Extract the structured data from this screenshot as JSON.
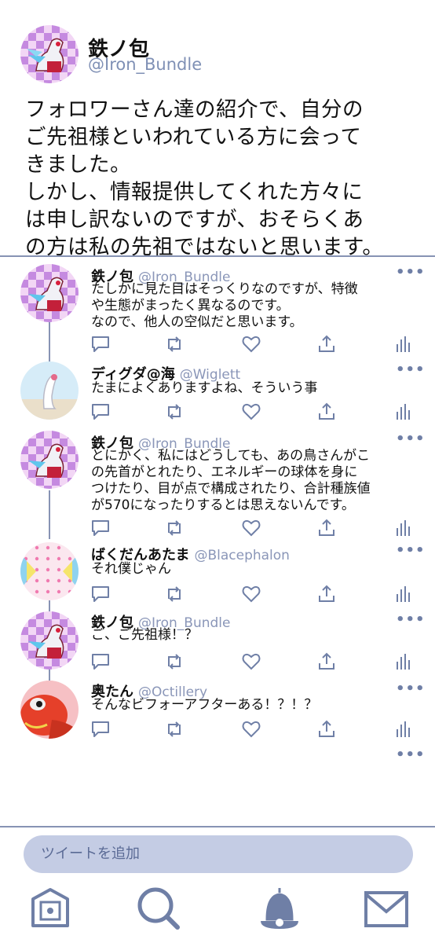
{
  "main_tweet": {
    "name": "鉄ノ包",
    "handle": "@Iron_Bundle",
    "text": "フォロワーさん達の紹介で、自分の\nご先祖様といわれている方に会って\nきました。\nしかし、情報提供してくれた方々に\nは申し訳ないのですが、おそらくあ\nの方は私の先祖ではないと思います。"
  },
  "replies": [
    {
      "name": "鉄ノ包",
      "handle": "@Iron_Bundle",
      "text": "たしかに見た目はそっくりなのですが、特徴\nや生態がまったく異なるのです。\nなので、他人の空似だと思います。",
      "avatar": "iron-bundle-avatar"
    },
    {
      "name": "ディグダ@海",
      "handle": "@Wiglett",
      "text": "たまによくありますよね、そういう事",
      "avatar": "wiglett-avatar"
    },
    {
      "name": "鉄ノ包",
      "handle": "@Iron_Bundle",
      "text": "とにかく、私にはどうしても、あの鳥さんがこ\nの先首がとれたり、エネルギーの球体を身に\nつけたり、目が点で構成されたり、合計種族値\nが570になったりするとは思えないんです。",
      "avatar": "iron-bundle-avatar"
    },
    {
      "name": "ばくだんあたま",
      "handle": "@Blacephalon",
      "text": "それ僕じゃん",
      "avatar": "blacephalon-avatar"
    },
    {
      "name": "鉄ノ包",
      "handle": "@Iron_Bundle",
      "text": "ご、ご先祖様！？",
      "avatar": "iron-bundle-avatar"
    },
    {
      "name": "奥たん",
      "handle": "@Octillery",
      "text": "そんなビフォーアフターある！？！？",
      "avatar": "octillery-avatar"
    }
  ],
  "more_label": "•••",
  "compose": {
    "placeholder": "ツイートを追加"
  },
  "tabs": [
    "home-icon",
    "search-icon",
    "notifications-icon",
    "messages-icon"
  ],
  "colors": {
    "accent": "#6f7fa6",
    "divider": "#8793b4",
    "compose_bg": "#c4cce4",
    "handle": "#8a96b8"
  }
}
